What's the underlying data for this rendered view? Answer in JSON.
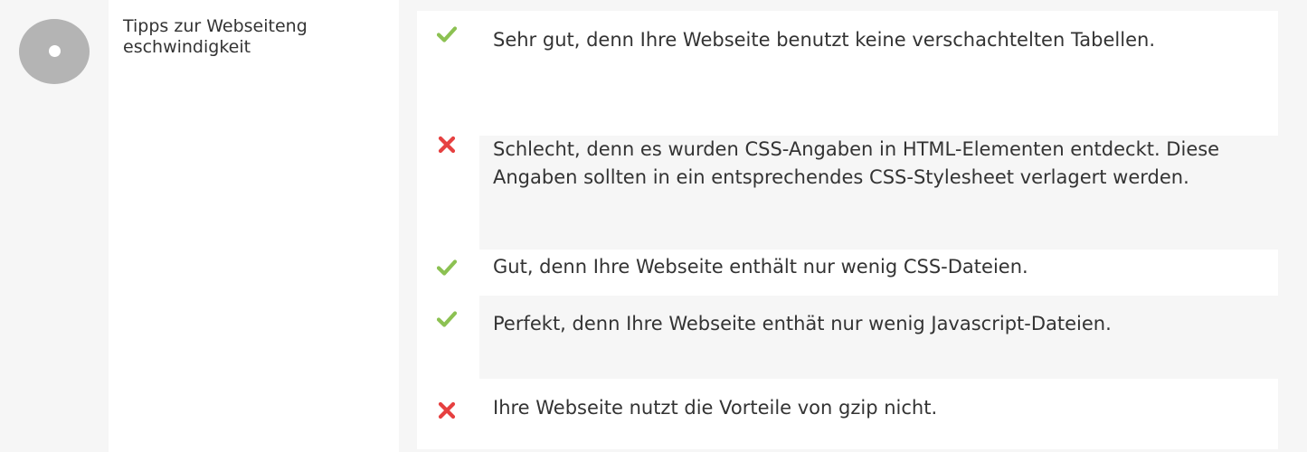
{
  "colors": {
    "background": "#f6f6f6",
    "panel": "#ffffff",
    "status_circle": "#b4b4b4",
    "check": "#8cc152",
    "cross": "#e64040",
    "text": "#333333"
  },
  "section": {
    "status_icon": "circle-dot-icon",
    "title": "Tipps zur Webseiteng eschwindigkeit"
  },
  "items": [
    {
      "status": "check-icon",
      "text": "Sehr gut, denn Ihre Webseite benutzt keine verschachtelten Tabellen."
    },
    {
      "status": "cross-icon",
      "text": "Schlecht, denn es wurden CSS-Angaben in HTML-Elementen entdeckt. Diese Angaben sollten in ein entsprechendes CSS-Stylesheet verlagert werden."
    },
    {
      "status": "check-icon",
      "text": "Gut, denn Ihre Webseite enthält nur wenig CSS-Dateien."
    },
    {
      "status": "check-icon",
      "text": "Perfekt, denn Ihre Webseite enthät nur wenig Javascript-Dateien."
    },
    {
      "status": "cross-icon",
      "text": "Ihre Webseite nutzt die Vorteile von gzip nicht."
    }
  ]
}
